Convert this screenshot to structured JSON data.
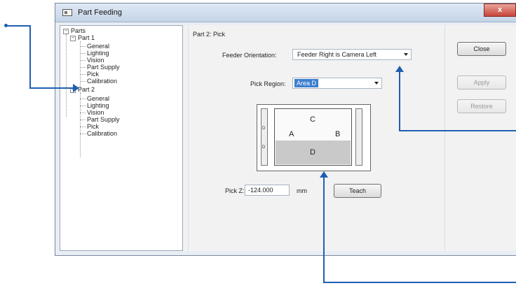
{
  "window": {
    "title": "Part Feeding",
    "close_glyph": "x"
  },
  "tree": {
    "root": "Parts",
    "part1": {
      "label": "Part 1",
      "children": [
        "General",
        "Lighting",
        "Vision",
        "Part Supply",
        "Pick",
        "Calibration"
      ]
    },
    "part2": {
      "label": "Part 2",
      "children": [
        "General",
        "Lighting",
        "Vision",
        "Part Supply",
        "Pick",
        "Calibration"
      ]
    },
    "toggle_glyph": "−"
  },
  "panel": {
    "title": "Part 2: Pick",
    "feeder_orientation_label": "Feeder Orientation:",
    "feeder_orientation_value": "Feeder Right is Camera Left",
    "pick_region_label": "Pick Region:",
    "pick_region_value": "Area D",
    "diagram_areas": {
      "a": "A",
      "b": "B",
      "c": "C",
      "d": "D"
    },
    "side_letter_left": "D",
    "pick_z_label": "Pick Z:",
    "pick_z_value": "-124.000",
    "pick_z_unit": "mm",
    "teach_label": "Teach"
  },
  "buttons": {
    "close": "Close",
    "apply": "Apply",
    "restore": "Restore"
  },
  "colors": {
    "callout": "#1f5fb3",
    "selection": "#3c7fd0"
  }
}
